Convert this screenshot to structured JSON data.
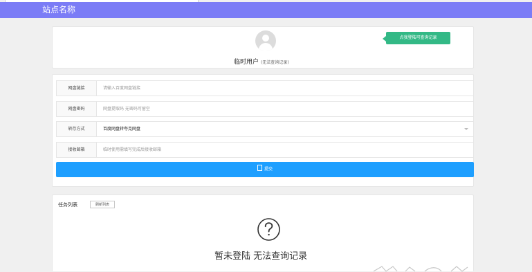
{
  "header": {
    "site_name": "站点名称"
  },
  "profile": {
    "username": "临时用户",
    "username_note": "(无法查询记录)",
    "login_button": "点我登陆可查询记录"
  },
  "form": {
    "fields": [
      {
        "label": "网盘链接",
        "placeholder": "请输入百度网盘链接"
      },
      {
        "label": "网盘密码",
        "placeholder": "网盘提取码 无密码可留空"
      },
      {
        "label": "转存方式",
        "value": "百度网盘转夸克网盘"
      },
      {
        "label": "接收邮箱",
        "placeholder": "临时使用需填写完成后接收邮箱"
      }
    ],
    "submit_label": "提交"
  },
  "tasks": {
    "title": "任务列表",
    "refresh_label": "刷新列表",
    "empty_message": "暂未登陆 无法查询记录"
  },
  "colors": {
    "header": "#7b7cf6",
    "login_button": "#33b986",
    "submit": "#1e9fff"
  }
}
